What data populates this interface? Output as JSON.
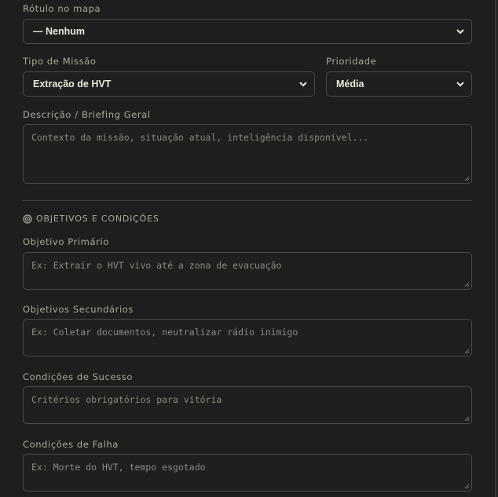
{
  "map_label": {
    "label": "Rótulo no mapa",
    "value": "— Nenhum"
  },
  "mission_type": {
    "label": "Tipo de Missão",
    "value": "Extração de HVT"
  },
  "priority": {
    "label": "Prioridade",
    "value": "Média"
  },
  "briefing": {
    "label": "Descrição / Briefing Geral",
    "placeholder": "Contexto da missão, situação atual, inteligência disponível..."
  },
  "objectives_section": {
    "title": "OBJETIVOS E CONDIÇÕES",
    "icon": "target-icon"
  },
  "primary_objective": {
    "label": "Objetivo Primário",
    "placeholder": "Ex: Extrair o HVT vivo até a zona de evacuação"
  },
  "secondary_objectives": {
    "label": "Objetivos Secundários",
    "placeholder": "Ex: Coletar documentos, neutralizar rádio inimigo"
  },
  "success_conditions": {
    "label": "Condições de Sucesso",
    "placeholder": "Critérios obrigatórios para vitória"
  },
  "failure_conditions": {
    "label": "Condições de Falha",
    "placeholder": "Ex: Morte do HVT, tempo esgotado"
  }
}
